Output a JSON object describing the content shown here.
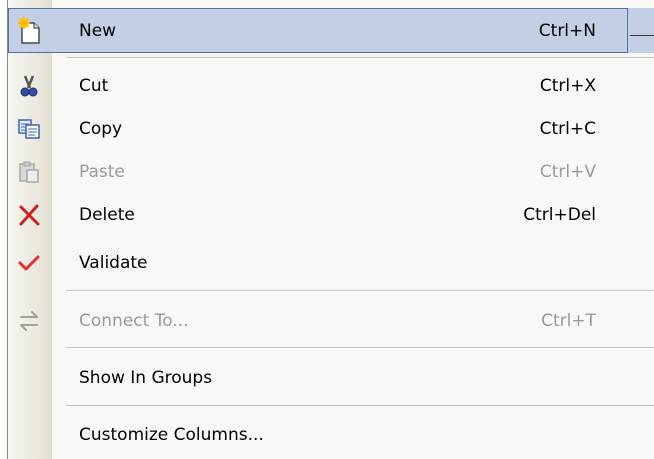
{
  "menu": {
    "items": [
      {
        "label": "New",
        "shortcut": "Ctrl+N",
        "icon": "new-document-icon",
        "enabled": true,
        "highlighted": true
      },
      {
        "label": "Cut",
        "shortcut": "Ctrl+X",
        "icon": "scissors-icon",
        "enabled": true
      },
      {
        "label": "Copy",
        "shortcut": "Ctrl+C",
        "icon": "copy-icon",
        "enabled": true
      },
      {
        "label": "Paste",
        "shortcut": "Ctrl+V",
        "icon": "paste-icon",
        "enabled": false
      },
      {
        "label": "Delete",
        "shortcut": "Ctrl+Del",
        "icon": "delete-x-icon",
        "enabled": true
      },
      {
        "label": "Validate",
        "shortcut": "",
        "icon": "checkmark-icon",
        "enabled": true
      },
      {
        "label": "Connect To...",
        "shortcut": "Ctrl+T",
        "icon": "connect-arrows-icon",
        "enabled": false
      },
      {
        "label": "Show In Groups",
        "shortcut": "",
        "icon": "",
        "enabled": true
      },
      {
        "label": "Customize Columns...",
        "shortcut": "",
        "icon": "",
        "enabled": true
      }
    ],
    "colors": {
      "highlight": "#c2cfe5",
      "highlight_border": "#4e6fa8",
      "disabled_text": "#9a9a9a",
      "delete_red": "#d22020",
      "check_red": "#e03030"
    }
  }
}
